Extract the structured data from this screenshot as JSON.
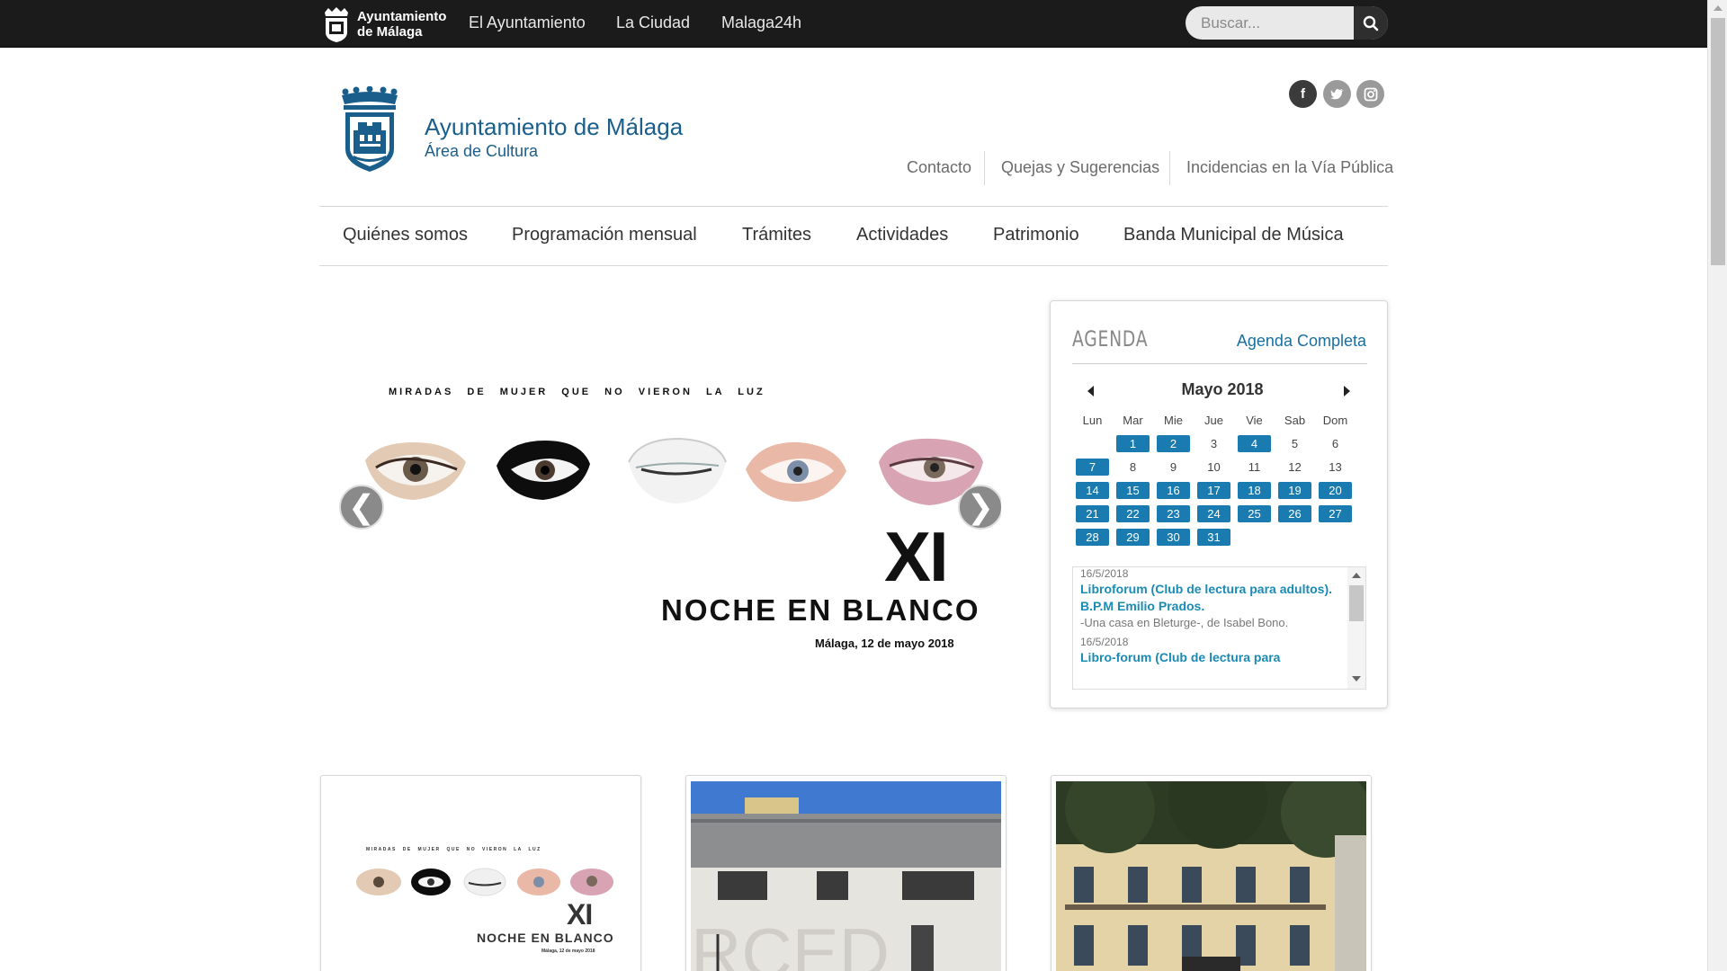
{
  "topbar": {
    "brand_line1": "Ayuntamiento",
    "brand_line2": "de Málaga",
    "nav": [
      "El Ayuntamiento",
      "La Ciudad",
      "Malaga24h"
    ],
    "search_placeholder": "Buscar...",
    "background": "#1b1b1b"
  },
  "header": {
    "title": "Ayuntamiento de Málaga",
    "subtitle": "Área de Cultura",
    "brand_color": "#1a5f8c",
    "social": [
      "facebook-icon",
      "twitter-icon",
      "instagram-icon"
    ],
    "links": [
      "Contacto",
      "Quejas y Sugerencias",
      "Incidencias en la Vía Pública"
    ]
  },
  "mainnav": {
    "items": [
      "Quiénes somos",
      "Programación mensual",
      "Trámites",
      "Actividades",
      "Patrimonio",
      "Banda Municipal de Música"
    ]
  },
  "slider": {
    "caption": "MIRADAS DE MUJER QUE NO VIERON LA LUZ",
    "headline": "XI",
    "title": "NOCHE EN BLANCO",
    "date": "Málaga, 12 de mayo 2018",
    "prev": "❮",
    "next": "❯"
  },
  "agenda": {
    "title": "AGENDA",
    "full_link": "Agenda Completa",
    "month": "Mayo 2018",
    "weekdays": [
      "Lun",
      "Mar",
      "Mie",
      "Jue",
      "Vie",
      "Sab",
      "Dom"
    ],
    "weeks": [
      [
        null,
        1,
        2,
        3,
        4,
        5,
        6
      ],
      [
        7,
        8,
        9,
        10,
        11,
        12,
        13
      ],
      [
        14,
        15,
        16,
        17,
        18,
        19,
        20
      ],
      [
        21,
        22,
        23,
        24,
        25,
        26,
        27
      ],
      [
        28,
        29,
        30,
        31,
        null,
        null,
        null
      ]
    ],
    "event_days": [
      1,
      2,
      4,
      7,
      14,
      15,
      16,
      17,
      18,
      19,
      20,
      21,
      22,
      23,
      24,
      25,
      26,
      27,
      28,
      29,
      30,
      31
    ],
    "accent": "#1a7bb0",
    "events": [
      {
        "date": "16/5/2018",
        "title": "Libroforum (Club de lectura para adultos). B.P.M Emilio Prados.",
        "desc": "-Una casa en Bleturge-, de Isabel Bono."
      },
      {
        "date": "16/5/2018",
        "title": "Libro-forum (Club de lectura para",
        "desc": ""
      }
    ]
  },
  "cards": {
    "card1": {
      "caption": "MIRADAS DE MUJER QUE NO VIERON LA LUZ",
      "headline": "XI",
      "title": "NOCHE EN BLANCO",
      "date": "Málaga, 12 de mayo 2018"
    },
    "card2": {
      "sign": "RCED"
    }
  }
}
